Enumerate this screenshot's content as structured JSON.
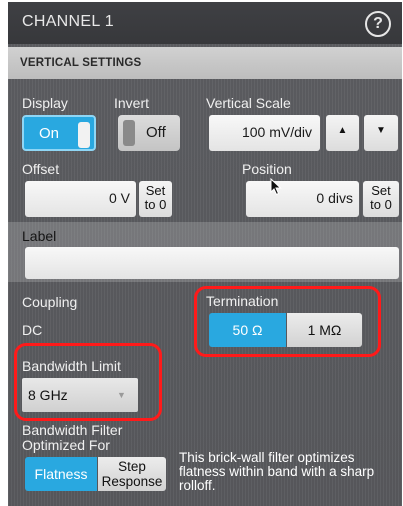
{
  "panel": {
    "title": "CHANNEL 1",
    "help_glyph": "?"
  },
  "section": {
    "title": "VERTICAL SETTINGS"
  },
  "display": {
    "label": "Display",
    "value": "On"
  },
  "invert": {
    "label": "Invert",
    "value": "Off"
  },
  "vertical_scale": {
    "label": "Vertical Scale",
    "value": "100 mV/div",
    "up_glyph": "▲",
    "down_glyph": "▼"
  },
  "offset": {
    "label": "Offset",
    "value": "0 V",
    "set_line1": "Set",
    "set_line2": "to 0"
  },
  "position": {
    "label": "Position",
    "value": "0 divs",
    "set_line1": "Set",
    "set_line2": "to 0"
  },
  "label_field": {
    "label": "Label",
    "value": ""
  },
  "coupling": {
    "label": "Coupling",
    "value": "DC"
  },
  "termination": {
    "label": "Termination",
    "options": [
      "50 Ω",
      "1 MΩ"
    ],
    "selected": "50 Ω"
  },
  "bandwidth_limit": {
    "label": "Bandwidth Limit",
    "value": "8 GHz",
    "arrow_glyph": "▼"
  },
  "bandwidth_filter": {
    "label_line1": "Bandwidth Filter",
    "label_line2": "Optimized For",
    "options": [
      "Flatness",
      "Step",
      "Response"
    ],
    "selected": "Flatness",
    "description": "This brick-wall filter optimizes flatness within band with a sharp rolloff."
  },
  "colors": {
    "accent": "#29a8e0",
    "highlight_box": "#ff1a1a",
    "panel_bg": "#5b5c60"
  }
}
